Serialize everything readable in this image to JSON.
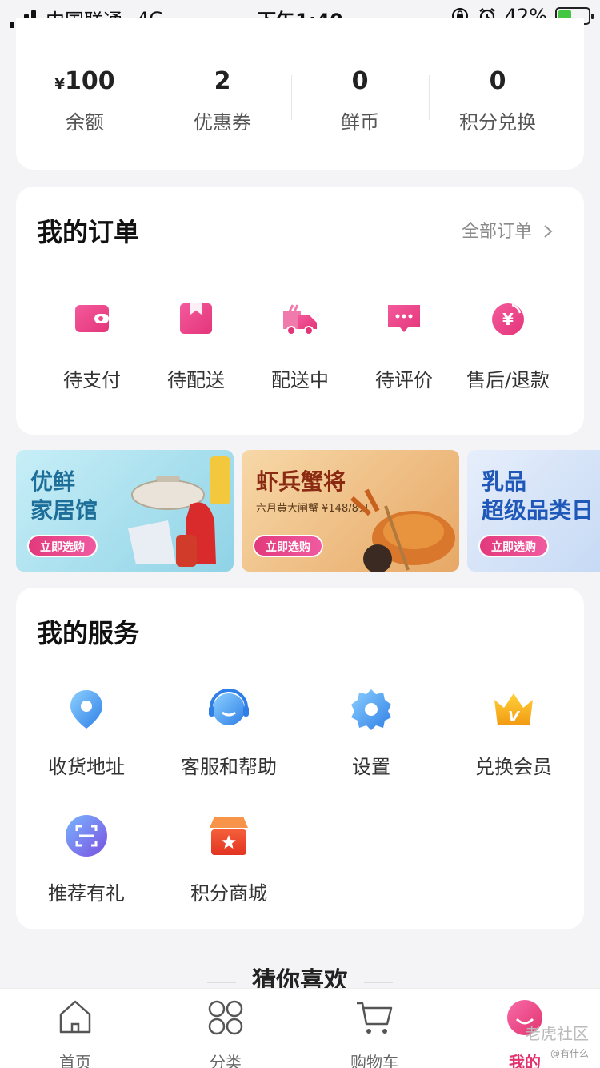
{
  "status_bar": {
    "carrier": "中国联通",
    "network": "4G",
    "time": "下午1:40",
    "battery": "42%"
  },
  "assets": [
    {
      "currency": "¥",
      "value": "100",
      "label": "余额"
    },
    {
      "currency": "",
      "value": "2",
      "label": "优惠券"
    },
    {
      "currency": "",
      "value": "0",
      "label": "鲜币"
    },
    {
      "currency": "",
      "value": "0",
      "label": "积分兑换"
    }
  ],
  "orders": {
    "title": "我的订单",
    "all_label": "全部订单",
    "items": [
      {
        "label": "待支付",
        "icon": "wallet-icon"
      },
      {
        "label": "待配送",
        "icon": "package-icon"
      },
      {
        "label": "配送中",
        "icon": "delivery-truck-icon"
      },
      {
        "label": "待评价",
        "icon": "comment-icon"
      },
      {
        "label": "售后/退款",
        "icon": "refund-icon"
      }
    ]
  },
  "banners": [
    {
      "title_1": "优鲜",
      "title_2": "家居馆",
      "subtitle": "",
      "button": "立即选购",
      "bg": "#bfe7f2"
    },
    {
      "title_1": "虾兵蟹将",
      "title_2": "",
      "subtitle": "六月黄大闸蟹 ¥148/8只",
      "button": "立即选购",
      "bg": "#f1c893"
    },
    {
      "title_1": "乳品",
      "title_2": "超级品类日",
      "subtitle": "",
      "button": "立即选购",
      "bg": "#d4e3f7"
    }
  ],
  "services": {
    "title": "我的服务",
    "items": [
      {
        "label": "收货地址",
        "icon": "location-pin-icon"
      },
      {
        "label": "客服和帮助",
        "icon": "customer-service-icon"
      },
      {
        "label": "设置",
        "icon": "settings-gear-icon"
      },
      {
        "label": "兑换会员",
        "icon": "vip-crown-icon"
      },
      {
        "label": "推荐有礼",
        "icon": "scan-icon"
      },
      {
        "label": "积分商城",
        "icon": "store-icon"
      }
    ]
  },
  "guess_title": "猜你喜欢",
  "tabbar": [
    {
      "label": "首页",
      "icon": "home-icon"
    },
    {
      "label": "分类",
      "icon": "category-grid-icon"
    },
    {
      "label": "购物车",
      "icon": "cart-icon"
    },
    {
      "label": "我的",
      "icon": "profile-icon",
      "active": true
    }
  ],
  "watermark": {
    "main": "老虎社区",
    "sub": "@有什么"
  },
  "colors": {
    "accent": "#e2336f",
    "icon_pink": "#ef3f86",
    "icon_blue": "#3e8de8"
  }
}
